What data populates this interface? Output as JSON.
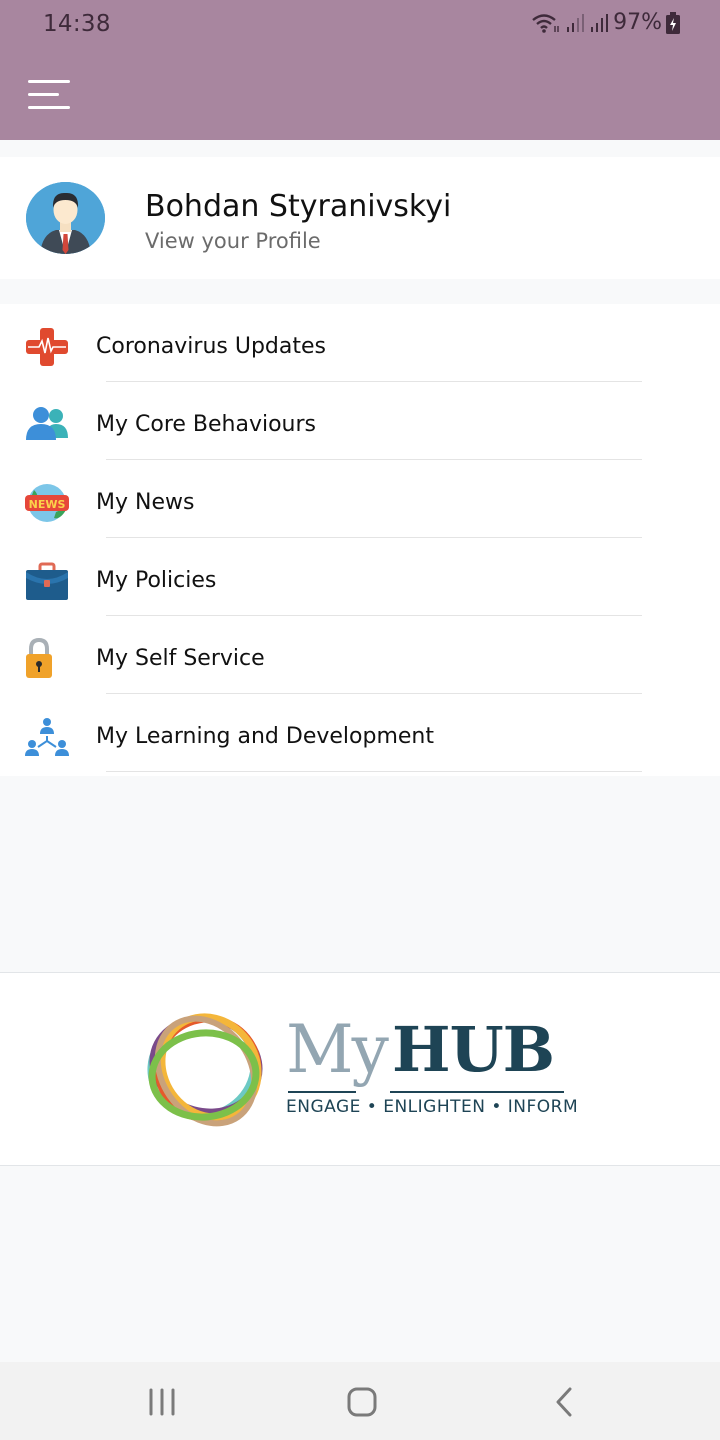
{
  "status_bar": {
    "time": "14:38",
    "battery": "97%",
    "icons": [
      "wifi-icon",
      "signal-icon",
      "signal-icon",
      "battery-charging-icon"
    ]
  },
  "app_bar": {
    "menu_icon": "hamburger-menu-icon"
  },
  "profile": {
    "name": "Bohdan Styranivskyi",
    "subtitle": "View your Profile",
    "avatar_icon": "businessman-avatar-icon"
  },
  "menu": {
    "items": [
      {
        "label": "Coronavirus Updates",
        "icon": "medical-cross-icon"
      },
      {
        "label": "My Core Behaviours",
        "icon": "users-icon"
      },
      {
        "label": "My News",
        "icon": "news-globe-icon"
      },
      {
        "label": "My Policies",
        "icon": "briefcase-icon"
      },
      {
        "label": "My Self Service",
        "icon": "padlock-icon"
      },
      {
        "label": "My Learning and Development",
        "icon": "team-hierarchy-icon"
      }
    ]
  },
  "logo": {
    "my": "My",
    "hub": "HUB",
    "tagline": "ENGAGE • ENLIGHTEN • INFORM"
  },
  "nav_bar": {
    "recents": "recents-icon",
    "home": "home-icon",
    "back": "back-icon"
  },
  "colors": {
    "app_bar": "#a8869f",
    "logo_dark": "#1e4455",
    "logo_light": "#93a6b2"
  }
}
